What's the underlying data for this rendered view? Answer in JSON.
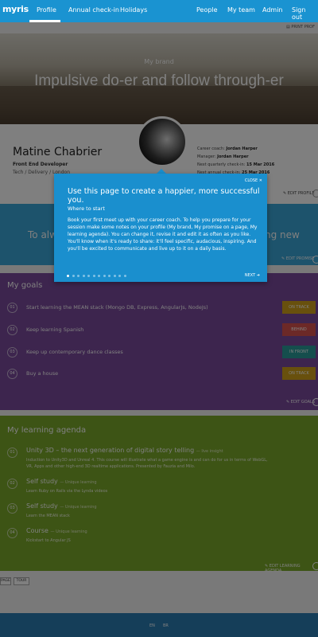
{
  "nav": {
    "logo": "myris",
    "left_items": [
      "Profile",
      "Annual check-in",
      "Holidays"
    ],
    "right_items": [
      "People",
      "My team",
      "Admin",
      "Sign out"
    ],
    "active": "Profile"
  },
  "toolbar": {
    "print_label": "PRINT PROF"
  },
  "hero": {
    "label": "My brand",
    "title": "Impulsive do-er and follow through-er"
  },
  "profile": {
    "name": "Matine Chabrier",
    "role": "Front End Developer",
    "department": "Tech / Delivery / London",
    "career_coach_label": "Career coach:",
    "career_coach": "Jordan Harper",
    "manager_label": "Manager:",
    "manager": "Jordan Harper",
    "next_quarterly_label": "Next quarterly check-in:",
    "next_quarterly": "15 Mar 2016",
    "next_annual_label": "Next annual check-in:",
    "next_annual": "25 Mar 2016",
    "edit_label": "EDIT PROFILE"
  },
  "promise": {
    "left_text": "To alw",
    "right_text": "ng new",
    "edit_label": "EDIT PROMISE"
  },
  "goals": {
    "title": "My goals",
    "items": [
      {
        "num": "01",
        "text": "Start learning the MEAN stack (Mongo DB, Express, AngularJs, NodeJs)",
        "status": "ON TRACK",
        "status_color": "#d0a01a"
      },
      {
        "num": "02",
        "text": "Keep learning Spanish",
        "status": "BEHIND",
        "status_color": "#d9534f"
      },
      {
        "num": "03",
        "text": "Keep up contemporary dance classes",
        "status": "IN FRONT",
        "status_color": "#2a9d9a"
      },
      {
        "num": "04",
        "text": "Buy a house",
        "status": "ON TRACK",
        "status_color": "#d0a01a"
      }
    ],
    "edit_label": "EDIT GOALS"
  },
  "agenda": {
    "title": "My learning agenda",
    "items": [
      {
        "num": "01",
        "title": "Unity 3D – the next generation of digital story telling",
        "sub": "— live insight",
        "desc": "Induction to Unity3D and Unreal 4. This course will illustrate what a game engine is and can do for us in terms of WebGL, VR, Apps and other high-end 3D realtime applications. Presented by Fauzia and Milo."
      },
      {
        "num": "02",
        "title": "Self study",
        "sub": "— Unique learning",
        "desc": "Learn Ruby on Rails via the Lynda videos"
      },
      {
        "num": "03",
        "title": "Self study",
        "sub": "— Unique learning",
        "desc": "Learn the MEAN stack"
      },
      {
        "num": "04",
        "title": "Course",
        "sub": "— Unique learning",
        "desc": "Kickstart to Angular JS"
      }
    ],
    "edit_label": "EDIT LEARNING AGENDA"
  },
  "footer_buttons": [
    "PAGE",
    "TOUR"
  ],
  "footer_langs": [
    "EN",
    "BR"
  ],
  "popover": {
    "close_label": "CLOSE",
    "title": "Use this page to create a happier, more successful you.",
    "subtitle": "Where to start",
    "body": "Book your first meet up with your career coach. To help you prepare for your session make some notes on your profile (My brand, My promise on a page, My learning agenda). You can change it, revise it and edit it as often as you like. You'll know when it's ready to share: it'll feel specific, audacious, inspiring. And you'll be excited to communicate and live up to it on a daily basis.",
    "next_label": "NEXT",
    "step_total": 12,
    "step_current": 1
  }
}
